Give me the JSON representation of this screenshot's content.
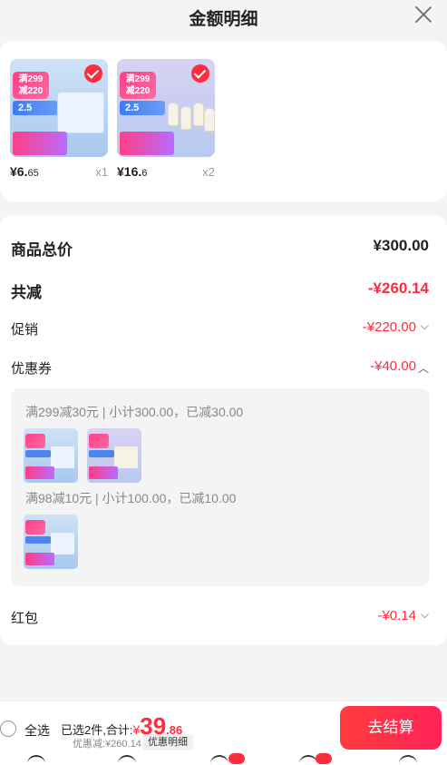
{
  "header": {
    "title": "金额明细"
  },
  "products": [
    {
      "price_int": "¥6.",
      "price_dec": "65",
      "qty": "x1",
      "promo": "满299\n减220",
      "tag": "2.5"
    },
    {
      "price_int": "¥16.",
      "price_dec": "6",
      "qty": "x2",
      "promo": "满299\n减220",
      "tag": "2.5"
    }
  ],
  "summary": {
    "total_label": "商品总价",
    "total_value": "¥300.00",
    "reduced_label": "共减",
    "reduced_value": "-¥260.14",
    "promo_label": "促销",
    "promo_value": "-¥220.00",
    "coupon_label": "优惠券",
    "coupon_value": "-¥40.00",
    "coupons": [
      {
        "text": "满299减30元 | 小计300.00，已减30.00"
      },
      {
        "text": "满98减10元 | 小计100.00，已减10.00"
      }
    ],
    "redpacket_label": "红包",
    "redpacket_value": "-¥0.14"
  },
  "bottom": {
    "select_all": "全选",
    "selected_text": "已选2件,合计:",
    "currency": "¥",
    "total_int": "39",
    "total_dec": ".86",
    "discount": "优惠减:¥260.14",
    "detail_button": "优惠明细",
    "checkout_button": "去结算"
  },
  "colors": {
    "accent": "#ff2c3c",
    "text": "#222222",
    "muted": "#888888"
  }
}
